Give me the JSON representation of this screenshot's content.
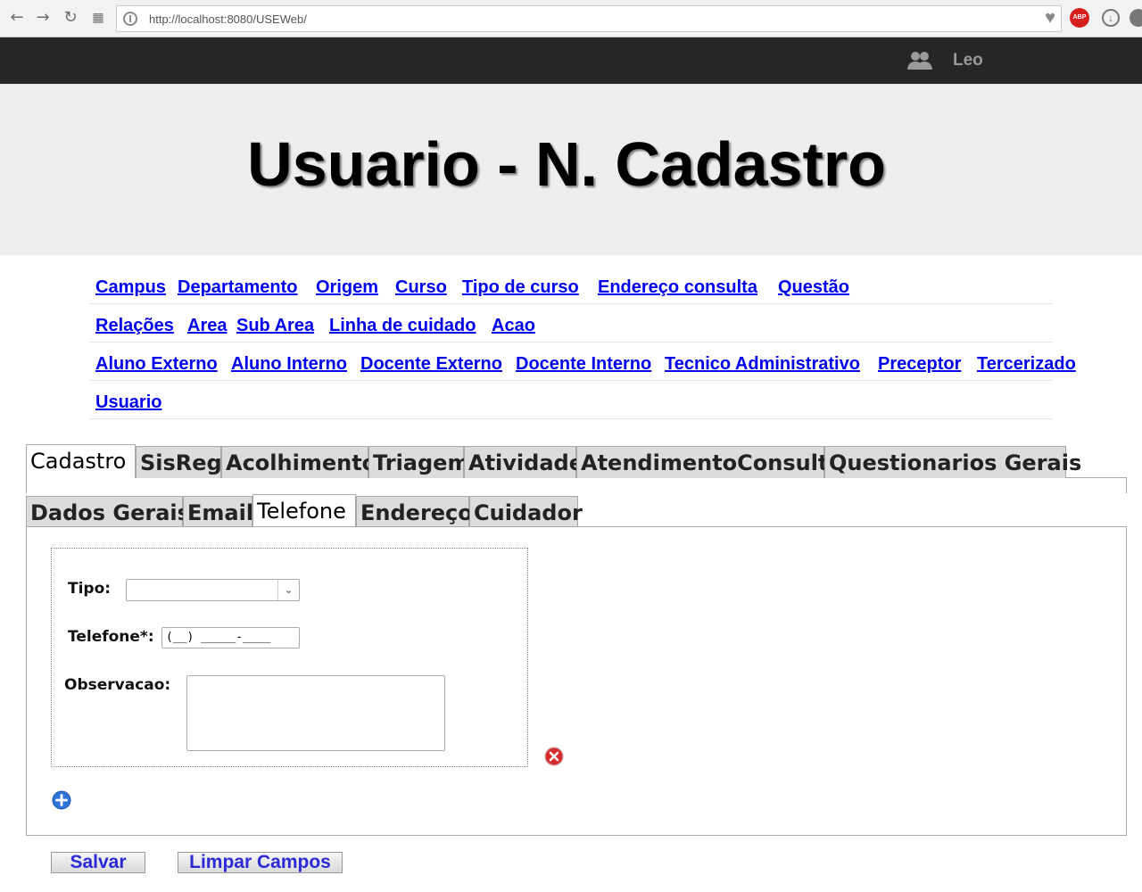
{
  "browser": {
    "url": "http://localhost:8080/USEWeb/",
    "adblock_label": "ABP"
  },
  "header": {
    "user_name": "Leo",
    "page_title": "Usuario - N. Cadastro"
  },
  "menu": {
    "rows": [
      [
        "Campus",
        "Departamento",
        "Origem",
        "Curso",
        "Tipo de curso",
        "Endereço consulta",
        "Questão"
      ],
      [
        "Relações",
        "Area",
        "Sub Area",
        "Linha de cuidado",
        "Acao"
      ],
      [
        "Aluno Externo",
        "Aluno Interno",
        "Docente Externo",
        "Docente Interno",
        "Tecnico Administrativo",
        "Preceptor",
        "Tercerizado"
      ],
      [
        "Usuario"
      ]
    ]
  },
  "main_tabs": [
    "Cadastro",
    "SisReg",
    "Acolhimento",
    "Triagem",
    "Atividade",
    "AtendimentoConsulta",
    "Questionarios Gerais"
  ],
  "main_tabs_active": "Cadastro",
  "sub_tabs": [
    "Dados Gerais",
    "Email",
    "Telefone",
    "Endereço",
    "Cuidador"
  ],
  "sub_tabs_active": "Telefone",
  "form": {
    "tipo_label": "Tipo:",
    "tipo_value": "",
    "telefone_label": "Telefone*:",
    "telefone_mask": "(__) _____-____",
    "observacao_label": "Observacao:",
    "observacao_value": ""
  },
  "buttons": {
    "save": "Salvar",
    "clear": "Limpar Campos"
  },
  "colors": {
    "link": "#0000ee",
    "topbar": "#262626",
    "hero_bg": "#eeeeee",
    "button_text": "#2b2bd6"
  }
}
